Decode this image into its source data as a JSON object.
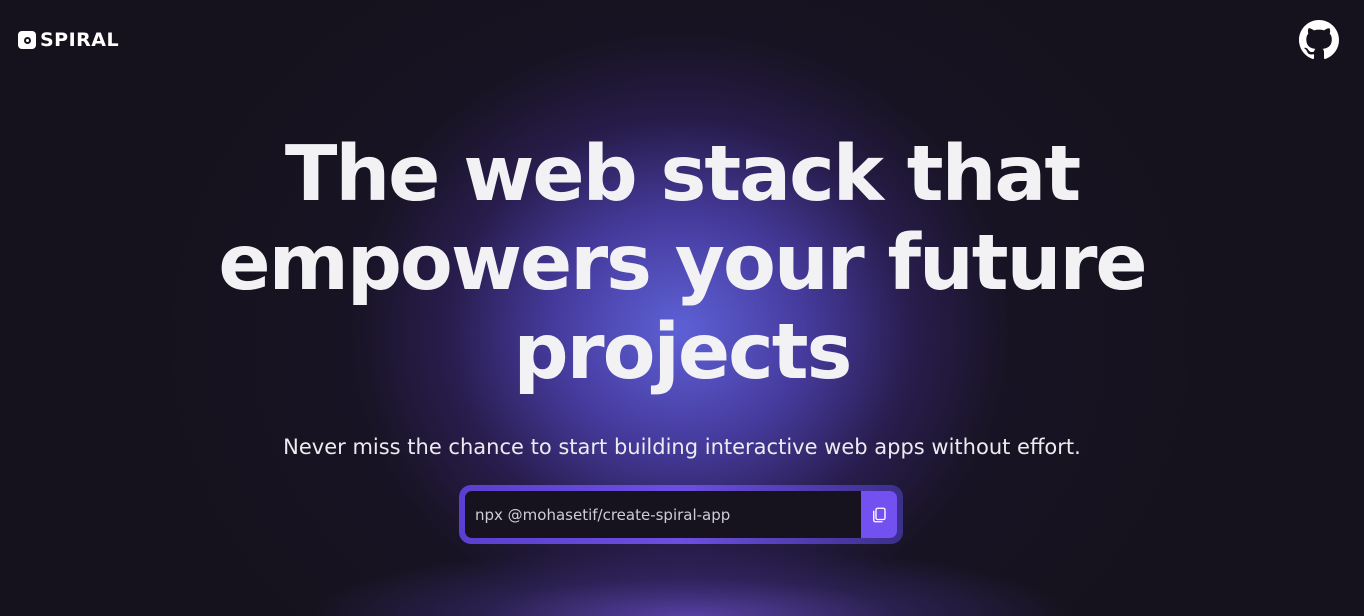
{
  "header": {
    "logo_text": "SPIRAL",
    "logo_icon": "spiral-logo-icon",
    "github_icon": "github-icon"
  },
  "hero": {
    "headline_line1": "The web stack that",
    "headline_line2": "empowers your future",
    "headline_line3": "projects",
    "subtitle": "Never miss the chance to start building interactive web apps without effort."
  },
  "command": {
    "text": "npx @mohasetif/create-spiral-app",
    "copy_icon": "copy-icon"
  },
  "colors": {
    "background": "#16121d",
    "accent": "#7351f0",
    "glow": "#5a5ad8",
    "text": "#f2f1f4"
  }
}
